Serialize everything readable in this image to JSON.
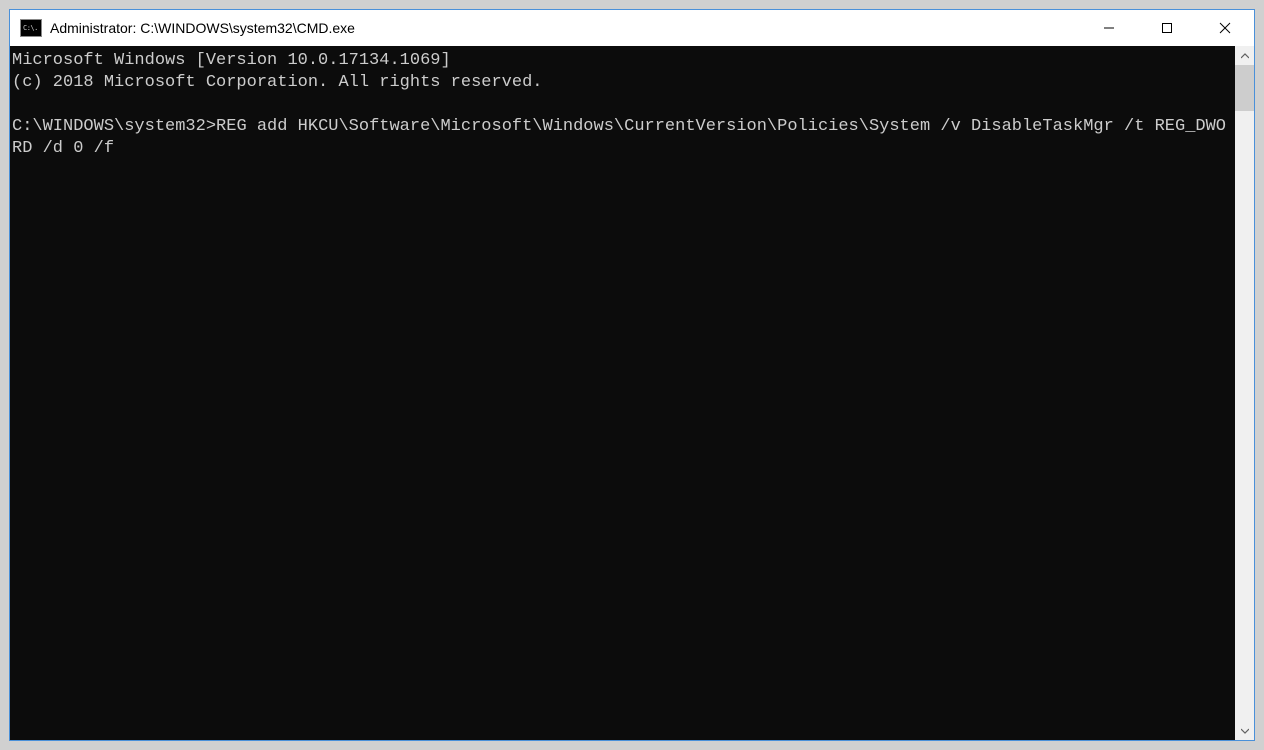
{
  "window": {
    "title": "Administrator: C:\\WINDOWS\\system32\\CMD.exe",
    "icon_text": "C:\\."
  },
  "terminal": {
    "line1": "Microsoft Windows [Version 10.0.17134.1069]",
    "line2": "(c) 2018 Microsoft Corporation. All rights reserved.",
    "blank": "",
    "prompt": "C:\\WINDOWS\\system32>",
    "command": "REG add HKCU\\Software\\Microsoft\\Windows\\CurrentVersion\\Policies\\System /v DisableTaskMgr /t REG_DWORD /d 0 /f"
  }
}
